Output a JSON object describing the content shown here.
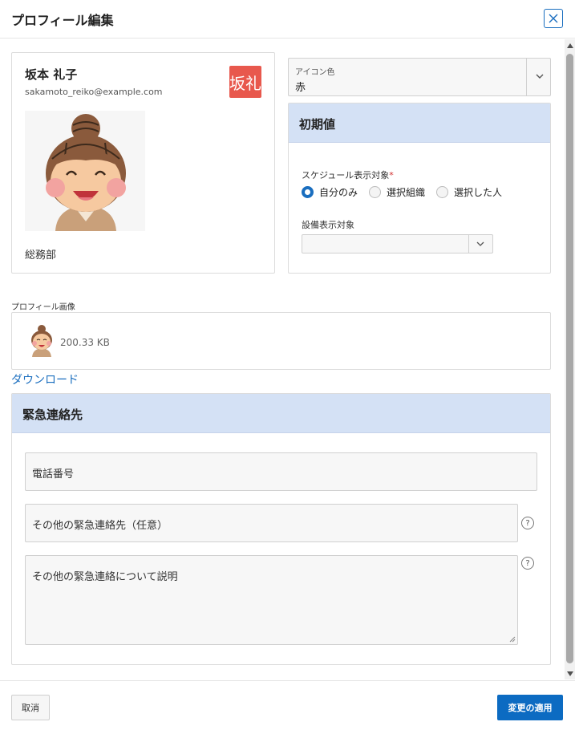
{
  "dialog": {
    "title": "プロフィール編集"
  },
  "user": {
    "name": "坂本 礼子",
    "email": "sakamoto_reiko@example.com",
    "badge": "坂礼",
    "badge_color": "#e8584d",
    "department": "総務部"
  },
  "icon_color": {
    "label": "アイコン色",
    "value": "赤"
  },
  "defaults": {
    "title": "初期値",
    "schedule_label": "スケジュール表示対象",
    "schedule_options": [
      {
        "label": "自分のみ",
        "selected": true
      },
      {
        "label": "選択組織",
        "selected": false
      },
      {
        "label": "選択した人",
        "selected": false
      }
    ],
    "equipment_label": "設備表示対象",
    "equipment_value": ""
  },
  "profile_image": {
    "label": "プロフィール画像",
    "file_size": "200.33 KB",
    "download_label": "ダウンロード"
  },
  "emergency": {
    "title": "緊急連絡先",
    "phone_placeholder": "電話番号",
    "other_placeholder": "その他の緊急連絡先（任意）",
    "description_placeholder": "その他の緊急連絡について説明",
    "help_icon": "?"
  },
  "footer": {
    "cancel_label": "取消",
    "apply_label": "変更の適用"
  },
  "colors": {
    "accent": "#0c6bc2",
    "section_header": "#d4e1f5"
  }
}
